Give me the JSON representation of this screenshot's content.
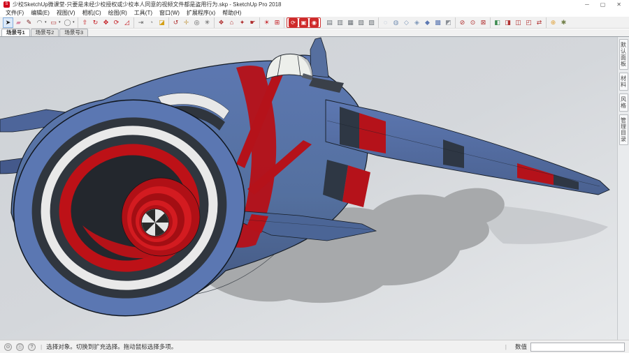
{
  "window": {
    "title": "少校SketchUp微课堂-只要是未经少校授权或少校本人同意的视频文件都是盗用行为.skp - SketchUp Pro 2018",
    "logo_glyph": "S",
    "controls": [
      {
        "name": "minimize-button",
        "glyph": "─"
      },
      {
        "name": "maximize-button",
        "glyph": "▢"
      },
      {
        "name": "close-button",
        "glyph": "✕"
      }
    ]
  },
  "menubar": {
    "items": [
      {
        "id": "file",
        "label": "文件(F)"
      },
      {
        "id": "edit",
        "label": "编辑(E)"
      },
      {
        "id": "view",
        "label": "视图(V)"
      },
      {
        "id": "camera",
        "label": "相机(C)"
      },
      {
        "id": "draw",
        "label": "绘图(R)"
      },
      {
        "id": "tools",
        "label": "工具(T)"
      },
      {
        "id": "window",
        "label": "窗口(W)"
      },
      {
        "id": "extensions",
        "label": "扩展程序(x)"
      },
      {
        "id": "help",
        "label": "帮助(H)"
      }
    ]
  },
  "toolbar": {
    "groups": [
      {
        "name": "principal-tools",
        "icons": [
          {
            "name": "select-tool",
            "glyph": "➤",
            "color": "#1a1a1a",
            "active": true
          },
          {
            "name": "eraser-tool",
            "glyph": "▰",
            "color": "#d98ca6"
          },
          {
            "name": "line-tool",
            "glyph": "✎",
            "color": "#7a2020"
          },
          {
            "name": "arc-tool",
            "glyph": "◠",
            "color": "#555555",
            "caret": true
          },
          {
            "name": "shapes-tool",
            "glyph": "▭",
            "color": "#b03030",
            "caret": true
          },
          {
            "name": "circle-tool",
            "glyph": "◯",
            "color": "#777777",
            "caret": true
          }
        ]
      },
      {
        "name": "edit-tools",
        "icons": [
          {
            "name": "push-pull-tool",
            "glyph": "⇧",
            "color": "#c3161c"
          },
          {
            "name": "follow-me-tool",
            "glyph": "↻",
            "color": "#c3161c"
          },
          {
            "name": "move-tool",
            "glyph": "✥",
            "color": "#c3161c"
          },
          {
            "name": "rotate-tool",
            "glyph": "⟳",
            "color": "#c3161c"
          },
          {
            "name": "scale-tool",
            "glyph": "◿",
            "color": "#c3161c"
          }
        ]
      },
      {
        "name": "construction-tools",
        "icons": [
          {
            "name": "tape-measure-tool",
            "glyph": "⇥",
            "color": "#666666"
          },
          {
            "name": "protractor-tool",
            "glyph": "◔",
            "color": "#888888"
          },
          {
            "name": "paint-bucket-tool",
            "glyph": "◪",
            "color": "#d4a017"
          }
        ]
      },
      {
        "name": "camera-tools",
        "icons": [
          {
            "name": "orbit-tool",
            "glyph": "↺",
            "color": "#b03030"
          },
          {
            "name": "pan-tool",
            "glyph": "✛",
            "color": "#c8a45a"
          },
          {
            "name": "zoom-tool",
            "glyph": "◎",
            "color": "#555555"
          },
          {
            "name": "zoom-extents-tool",
            "glyph": "✳",
            "color": "#555555"
          }
        ]
      },
      {
        "name": "component-tools",
        "icons": [
          {
            "name": "make-component-tool",
            "glyph": "❖",
            "color": "#b03030"
          },
          {
            "name": "3d-warehouse-tool",
            "glyph": "⌂",
            "color": "#b03030"
          },
          {
            "name": "extension-warehouse-tool",
            "glyph": "✦",
            "color": "#b03030"
          },
          {
            "name": "interact-tool",
            "glyph": "☛",
            "color": "#b03030"
          }
        ]
      },
      {
        "name": "shadow-tools",
        "icons": [
          {
            "name": "shadows-toggle",
            "glyph": "☀",
            "color": "#c3161c"
          },
          {
            "name": "fog-toggle",
            "glyph": "⊞",
            "color": "#c3161c"
          }
        ]
      },
      {
        "name": "plugin-tools",
        "boxed": true,
        "icons": [
          {
            "name": "plugin-refresh-tool",
            "glyph": "⟳",
            "color": "#ffffff",
            "boxed": true
          },
          {
            "name": "plugin-folder-tool",
            "glyph": "▣",
            "color": "#ffffff",
            "boxed": true
          },
          {
            "name": "plugin-camera-tool",
            "glyph": "◉",
            "color": "#ffffff",
            "boxed": true
          }
        ]
      },
      {
        "name": "standard-views",
        "icons": [
          {
            "name": "iso-view-button",
            "glyph": "▤",
            "color": "#6a7076"
          },
          {
            "name": "top-view-button",
            "glyph": "▥",
            "color": "#6a7076"
          },
          {
            "name": "front-view-button",
            "glyph": "▦",
            "color": "#6a7076"
          },
          {
            "name": "right-view-button",
            "glyph": "▧",
            "color": "#6a7076"
          },
          {
            "name": "back-view-button",
            "glyph": "▨",
            "color": "#6a7076"
          }
        ]
      },
      {
        "name": "face-styles",
        "icons": [
          {
            "name": "x-ray-style-button",
            "glyph": "◌",
            "color": "#7d96b8"
          },
          {
            "name": "back-edges-style-button",
            "glyph": "◍",
            "color": "#7d96b8"
          },
          {
            "name": "wireframe-style-button",
            "glyph": "◇",
            "color": "#7d96b8"
          },
          {
            "name": "hidden-line-style-button",
            "glyph": "◈",
            "color": "#7d96b8"
          },
          {
            "name": "shaded-style-button",
            "glyph": "◆",
            "color": "#5b77b2"
          },
          {
            "name": "textured-style-button",
            "glyph": "▩",
            "color": "#5b77b2"
          },
          {
            "name": "monochrome-style-button",
            "glyph": "◩",
            "color": "#8a8f96"
          }
        ]
      },
      {
        "name": "visibility-tools",
        "icons": [
          {
            "name": "hide-tool",
            "glyph": "⊘",
            "color": "#b03030"
          },
          {
            "name": "unhide-tool",
            "glyph": "⊙",
            "color": "#b03030"
          },
          {
            "name": "lock-tool",
            "glyph": "⊠",
            "color": "#b03030"
          }
        ]
      },
      {
        "name": "section-tools",
        "icons": [
          {
            "name": "section-plane-tool",
            "glyph": "◧",
            "color": "#3b8a4e"
          },
          {
            "name": "display-section-planes-button",
            "glyph": "◨",
            "color": "#b03030"
          },
          {
            "name": "display-section-cuts-button",
            "glyph": "◫",
            "color": "#b03030"
          },
          {
            "name": "section-fill-button",
            "glyph": "◰",
            "color": "#b03030"
          },
          {
            "name": "reverse-section-button",
            "glyph": "⇄",
            "color": "#b03030"
          }
        ]
      },
      {
        "name": "misc-tools",
        "icons": [
          {
            "name": "add-location-button",
            "glyph": "⊕",
            "color": "#e0a23a"
          },
          {
            "name": "extension-manager-button",
            "glyph": "✱",
            "color": "#72804a"
          }
        ]
      }
    ]
  },
  "scene_tabs": {
    "tabs": [
      {
        "label": "场景号1",
        "active": true
      },
      {
        "label": "场景号2",
        "active": false
      },
      {
        "label": "场景号3",
        "active": false
      }
    ]
  },
  "viewport": {
    "model": {
      "description": "Stylized blue-and-red cartoon jet aircraft with a large ducted front engine intake (blue rim, black and white rings, red inner ring, red spinner cone with black-white pinwheel hub), blue fuselage with red stripes, white bubble canopy, tail fin, long right wing with red and dark bands, casting a grey shadow on the ground",
      "colors": {
        "body_blue": "#54709f",
        "rim_blue": "#5b77b2",
        "accent_red": "#bd1117",
        "ring_dark": "#30363e",
        "ring_white": "#e9e9e9",
        "canopy_white": "#edefeb",
        "shadow_grey": "#a7a9ab",
        "background_top": "#ced2d7",
        "background_bottom": "#e7e9eb"
      }
    }
  },
  "tray": {
    "tabs": [
      {
        "label": "默认面板"
      },
      {
        "label": "材料"
      },
      {
        "label": "风格"
      },
      {
        "label": "管理目录"
      }
    ]
  },
  "statusbar": {
    "icons": [
      {
        "name": "geolocation-icon",
        "glyph": "⊙"
      },
      {
        "name": "credits-icon",
        "glyph": "ⓘ"
      },
      {
        "name": "help-icon",
        "glyph": "?"
      }
    ],
    "separator": "|",
    "hint": "选择对象。切换到扩充选择。拖动鼠标选择多项。",
    "measurement_label": "数值",
    "measurement_value": ""
  }
}
